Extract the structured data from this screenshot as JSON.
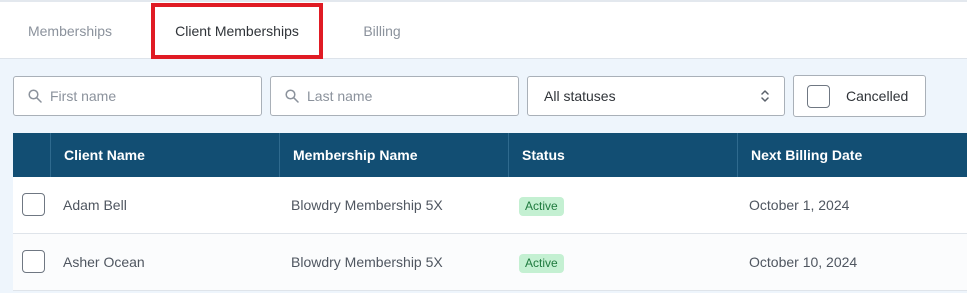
{
  "tabs": [
    {
      "label": "Memberships"
    },
    {
      "label": "Client Memberships"
    },
    {
      "label": "Billing"
    }
  ],
  "filters": {
    "first_name_placeholder": "First name",
    "last_name_placeholder": "Last name",
    "status_value": "All statuses",
    "cancelled_label": "Cancelled"
  },
  "table": {
    "headers": [
      "Client Name",
      "Membership Name",
      "Status",
      "Next Billing Date"
    ],
    "rows": [
      {
        "client": "Adam Bell",
        "membership": "Blowdry Membership 5X",
        "status": "Active",
        "next_billing": "October 1, 2024"
      },
      {
        "client": "Asher Ocean",
        "membership": "Blowdry Membership 5X",
        "status": "Active",
        "next_billing": "October 10, 2024"
      }
    ]
  },
  "colors": {
    "header_bg": "#124e73",
    "active_badge_bg": "#c4f0d2",
    "active_badge_text": "#1f7a3e",
    "highlight": "#e01b24"
  }
}
